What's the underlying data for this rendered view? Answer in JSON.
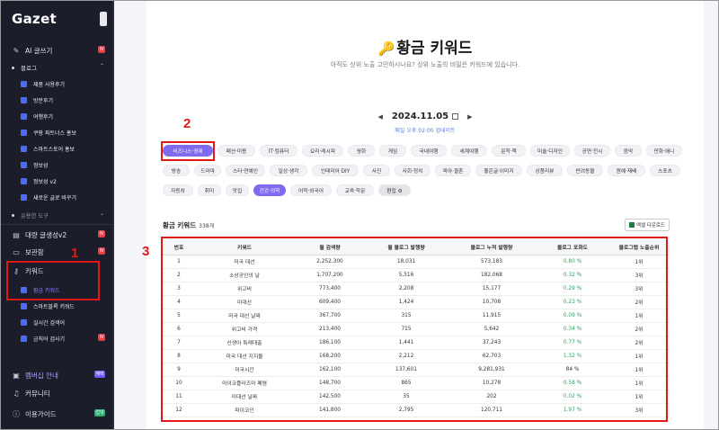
{
  "sidebar": {
    "logo": "Gazet",
    "items": [
      {
        "label": "AI 글쓰기",
        "badge": "N"
      },
      {
        "label": "블로그"
      },
      {
        "label": "제품 사용후기"
      },
      {
        "label": "방문후기"
      },
      {
        "label": "여행후기"
      },
      {
        "label": "쿠팡 파트너스 홍보"
      },
      {
        "label": "스마트스토어 홍보"
      },
      {
        "label": "정보성"
      },
      {
        "label": "정보성 v2"
      },
      {
        "label": "새로운 글로 바꾸기"
      },
      {
        "label": "유용한 도구"
      },
      {
        "label": "대량 글생성v2",
        "badge": "N"
      },
      {
        "label": "보관함",
        "badge": "N"
      },
      {
        "label": "키워드"
      },
      {
        "label": "황금 키워드"
      },
      {
        "label": "스마트블록 키워드"
      },
      {
        "label": "실시간 검색어"
      },
      {
        "label": "금칙어 검사기",
        "badge": "N"
      },
      {
        "label": "멤버십 안내",
        "badge": "혜택"
      },
      {
        "label": "커뮤니티"
      },
      {
        "label": "이용가이드",
        "badge": "업뎃"
      }
    ]
  },
  "main": {
    "title": "황금 키워드",
    "subtitle": "아직도 상위 노출 고민하시나요? 상위 노출의 비밀은 키워드에 있습니다.",
    "date": "2024.11.05",
    "update": "매일 오후 02:00 업데이트",
    "categories": [
      "비즈니스·경제",
      "패션·미용",
      "IT·컴퓨터",
      "요리·레시피",
      "영화",
      "게임",
      "국내여행",
      "세계여행",
      "문학·책",
      "미술·디자인",
      "공연·전시",
      "음악",
      "만화·애니",
      "방송",
      "드라마",
      "스타·연예인",
      "일상·생각",
      "인테리어·DIY",
      "사진",
      "사회·정치",
      "육아·결혼",
      "좋은글·이미지",
      "상품리뷰",
      "반려동물",
      "원예·재배",
      "스포츠",
      "자동차",
      "취미",
      "맛집",
      "건강·의학",
      "어학·외국어",
      "교육·학문",
      "편집 ⚙"
    ],
    "list_title": "황금 키워드",
    "list_count": "338개",
    "excel_label": "엑셀 다운로드",
    "columns": [
      "번호",
      "키워드",
      "월 검색량",
      "월 블로그 발행량",
      "블로그 누적 발행량",
      "블로그 포화도",
      "블로그탭 노출순위"
    ],
    "rows": [
      [
        "1",
        "미국 대선",
        "2,252,300",
        "18,031",
        "573,183",
        "0.80 %",
        "1위"
      ],
      [
        "2",
        "소상공인의 날",
        "1,707,200",
        "5,516",
        "182,068",
        "0.32 %",
        "3위"
      ],
      [
        "3",
        "위고비",
        "773,400",
        "2,208",
        "15,177",
        "0.29 %",
        "3위"
      ],
      [
        "4",
        "미대선",
        "609,400",
        "1,424",
        "10,708",
        "0.23 %",
        "2위"
      ],
      [
        "5",
        "미국 대선 날짜",
        "367,700",
        "315",
        "11,915",
        "0.09 %",
        "1위"
      ],
      [
        "6",
        "위고비 가격",
        "213,400",
        "715",
        "5,642",
        "0.34 %",
        "2위"
      ],
      [
        "7",
        "신생아 특례대출",
        "186,100",
        "1,441",
        "37,243",
        "0.77 %",
        "2위"
      ],
      [
        "8",
        "미국 대선 지지율",
        "168,200",
        "2,212",
        "62,703",
        "1.32 %",
        "1위"
      ],
      [
        "9",
        "미국시간",
        "162,100",
        "137,601",
        "9,281,931",
        "84 %",
        "1위"
      ],
      [
        "10",
        "마이코플라즈마 폐렴",
        "148,700",
        "865",
        "10,278",
        "0.58 %",
        "1위"
      ],
      [
        "11",
        "미대선 날짜",
        "142,500",
        "35",
        "202",
        "0.02 %",
        "1위"
      ],
      [
        "12",
        "파이코인",
        "141,800",
        "2,795",
        "120,711",
        "1.97 %",
        "3위"
      ]
    ]
  },
  "annotations": [
    "1",
    "2",
    "3"
  ],
  "colors": {
    "sidebar_bg": "#1b1d2a",
    "accent": "#7e6bef",
    "annotation": "#e01818",
    "positive": "#25a35a"
  }
}
